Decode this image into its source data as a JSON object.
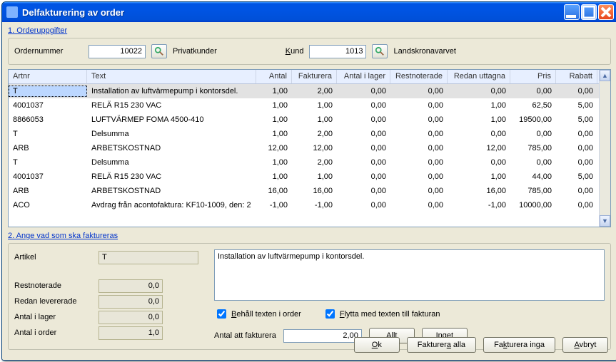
{
  "window": {
    "title": "Delfakturering av order"
  },
  "section1": {
    "link": "1. Orderuppgifter",
    "ordernr_label": "Ordernummer",
    "ordernr_value": "10022",
    "privatkunder": "Privatkunder",
    "kund_label": "Kund",
    "kund_value": "1013",
    "kund_name": "Landskronavarvet"
  },
  "table": {
    "headers": {
      "artnr": "Artnr",
      "text": "Text",
      "antal": "Antal",
      "fakturera": "Fakturera",
      "antal_lager": "Antal i lager",
      "restnoterade": "Restnoterade",
      "redan": "Redan uttagna",
      "pris": "Pris",
      "rabatt": "Rabatt"
    },
    "rows": [
      {
        "artnr": "T",
        "text": "Installation av luftvärmepump i kontorsdel.",
        "antal": "1,00",
        "fakturera": "2,00",
        "lager": "0,00",
        "rest": "0,00",
        "redan": "0,00",
        "pris": "0,00",
        "rabatt": "0,00",
        "sel": true
      },
      {
        "artnr": "4001037",
        "text": "RELÄ R15 230 VAC",
        "antal": "1,00",
        "fakturera": "1,00",
        "lager": "0,00",
        "rest": "0,00",
        "redan": "1,00",
        "pris": "62,50",
        "rabatt": "5,00"
      },
      {
        "artnr": "8866053",
        "text": "LUFTVÄRMEP FOMA 4500-410",
        "antal": "1,00",
        "fakturera": "1,00",
        "lager": "0,00",
        "rest": "0,00",
        "redan": "1,00",
        "pris": "19500,00",
        "rabatt": "5,00"
      },
      {
        "artnr": "T",
        "text": "Delsumma",
        "antal": "1,00",
        "fakturera": "2,00",
        "lager": "0,00",
        "rest": "0,00",
        "redan": "0,00",
        "pris": "0,00",
        "rabatt": "0,00"
      },
      {
        "artnr": "ARB",
        "text": "ARBETSKOSTNAD",
        "antal": "12,00",
        "fakturera": "12,00",
        "lager": "0,00",
        "rest": "0,00",
        "redan": "12,00",
        "pris": "785,00",
        "rabatt": "0,00"
      },
      {
        "artnr": "T",
        "text": "Delsumma",
        "antal": "1,00",
        "fakturera": "2,00",
        "lager": "0,00",
        "rest": "0,00",
        "redan": "0,00",
        "pris": "0,00",
        "rabatt": "0,00"
      },
      {
        "artnr": "4001037",
        "text": "RELÄ R15 230 VAC",
        "antal": "1,00",
        "fakturera": "1,00",
        "lager": "0,00",
        "rest": "0,00",
        "redan": "1,00",
        "pris": "44,00",
        "rabatt": "5,00"
      },
      {
        "artnr": "ARB",
        "text": "ARBETSKOSTNAD",
        "antal": "16,00",
        "fakturera": "16,00",
        "lager": "0,00",
        "rest": "0,00",
        "redan": "16,00",
        "pris": "785,00",
        "rabatt": "0,00"
      },
      {
        "artnr": "ACO",
        "text": "Avdrag från acontofaktura: KF10-1009, den: 2",
        "antal": "-1,00",
        "fakturera": "-1,00",
        "lager": "0,00",
        "rest": "0,00",
        "redan": "-1,00",
        "pris": "10000,00",
        "rabatt": "0,00"
      }
    ]
  },
  "section2": {
    "link": "2. Ange vad som ska faktureras",
    "artikel_label": "Artikel",
    "artikel_value": "T",
    "restnoterade_label": "Restnoterade",
    "restnoterade_value": "0,0",
    "redan_lev_label": "Redan levererade",
    "redan_lev_value": "0,0",
    "antal_lager_label": "Antal i lager",
    "antal_lager_value": "0,0",
    "antal_order_label": "Antal i order",
    "antal_order_value": "1,0",
    "textarea": "Installation av luftvärmepump i kontorsdel.",
    "chk_behall_pre": "B",
    "chk_behall_rest": "ehåll texten i order",
    "chk_flytta_pre": "F",
    "chk_flytta_rest": "lytta med texten till fakturan",
    "antal_fakt_label": "Antal att fakturera",
    "antal_fakt_value": "2,00",
    "btn_allt_pre": "A",
    "btn_allt_rest": "llt",
    "btn_inget_pre": "I",
    "btn_inget_rest": "nget"
  },
  "footer": {
    "ok_pre": "O",
    "ok_rest": "k",
    "fakt_alla_pre": "a",
    "fakt_alla_before": "Fakturer",
    "fakt_alla_after": " alla",
    "fakt_inga_pre": "k",
    "fakt_inga_before": "Fa",
    "fakt_inga_after": "turera inga",
    "avbryt_pre": "A",
    "avbryt_rest": "vbryt"
  }
}
